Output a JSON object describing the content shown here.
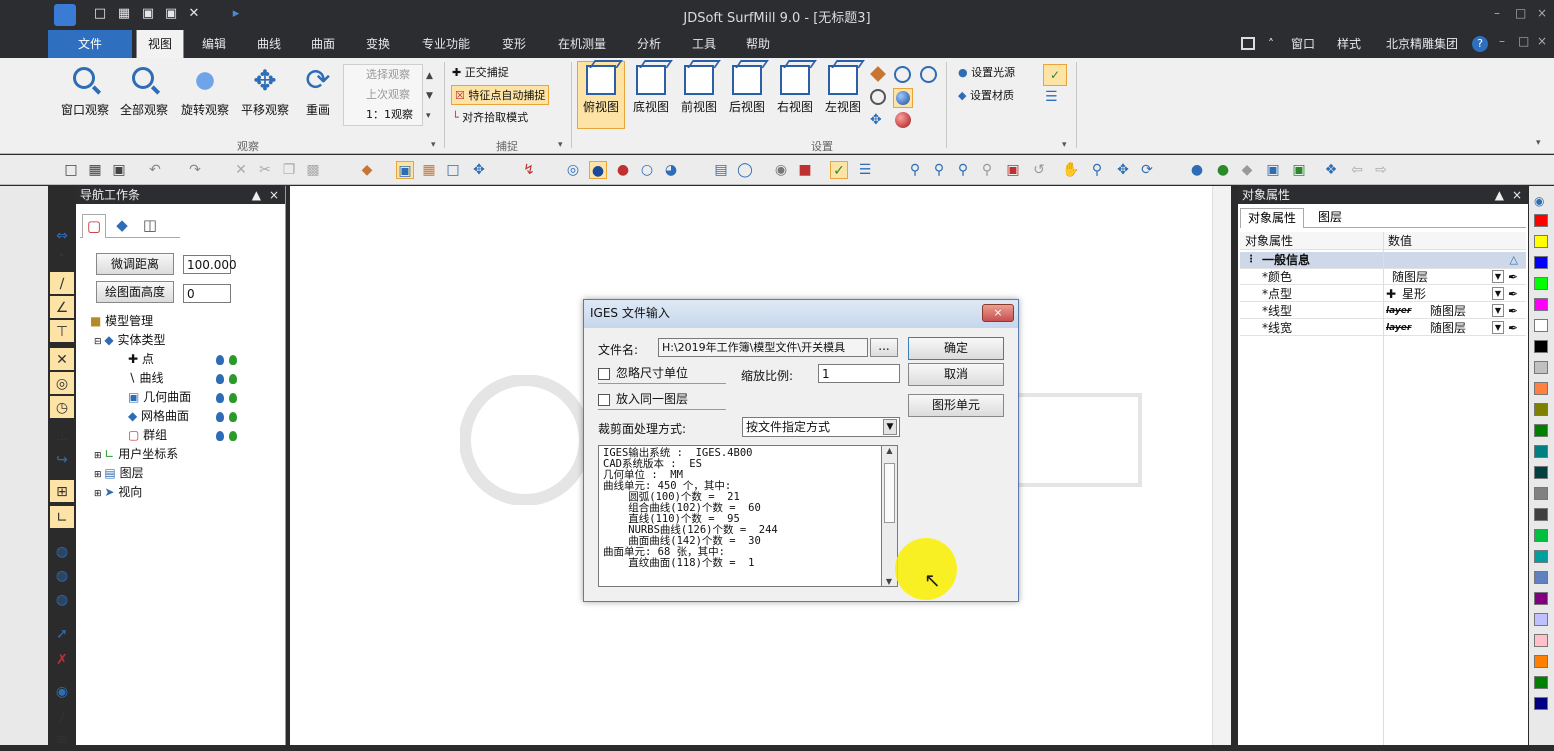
{
  "app": {
    "title": "JDSoft SurfMill 9.0 - [无标题3]",
    "window": {
      "min": "–",
      "max": "□",
      "close": "×"
    }
  },
  "menu": {
    "file": "文件",
    "tabs": [
      "视图",
      "编辑",
      "曲线",
      "曲面",
      "变换",
      "专业功能",
      "变形",
      "在机测量",
      "分析",
      "工具",
      "帮助"
    ],
    "right": {
      "window": "窗口",
      "style": "样式",
      "company": "北京精雕集团",
      "help": "?"
    }
  },
  "ribbon": {
    "observe": {
      "buttons": [
        "窗口观察",
        "全部观察",
        "旋转观察",
        "平移观察",
        "重画"
      ],
      "small": [
        "选择观察",
        "上次观察",
        "1：1观察"
      ],
      "label": "观察"
    },
    "snap": {
      "items": [
        "正交捕捉",
        "特征点自动捕捉",
        "对齐拾取模式"
      ],
      "label": "捕捉"
    },
    "settings": {
      "views": [
        "俯视图",
        "底视图",
        "前视图",
        "后视图",
        "右视图",
        "左视图"
      ],
      "light": "设置光源",
      "material": "设置材质",
      "label": "设置"
    }
  },
  "nav": {
    "title": "导航工作条",
    "fine_label": "微调距离",
    "fine_value": "100.000",
    "draw_label": "绘图面高度",
    "draw_value": "0",
    "tree": {
      "root": "模型管理",
      "entity": "实体类型",
      "children": [
        "点",
        "曲线",
        "几何曲面",
        "网格曲面",
        "群组"
      ],
      "ucs": "用户坐标系",
      "layer": "图层",
      "view": "视向"
    }
  },
  "dialog": {
    "title": "IGES 文件输入",
    "file_label": "文件名:",
    "file_value": "H:\\2019年工作簿\\模型文件\\开关模具",
    "browse": "...",
    "ok": "确定",
    "cancel": "取消",
    "unit_btn": "图形单元",
    "ignore_unit": "忽略尺寸单位",
    "same_layer": "放入同一图层",
    "scale_label": "缩放比例:",
    "scale_value": "1",
    "trim_label": "裁剪面处理方式:",
    "trim_value": "按文件指定方式",
    "info": [
      "IGES输出系统 :  IGES.4B00",
      "CAD系统版本 :  ES",
      "几何单位 :  MM",
      "曲线单元: 450 个，其中:",
      "    圆弧(100)个数 =  21",
      "    组合曲线(102)个数 =  60",
      "    直线(110)个数 =  95",
      "    NURBS曲线(126)个数 =  244",
      "    曲面曲线(142)个数 =  30",
      "曲面单元: 68 张，其中:",
      "    直纹曲面(118)个数 =  1"
    ]
  },
  "props": {
    "title": "对象属性",
    "tabs": [
      "对象属性",
      "图层"
    ],
    "col_prop": "对象属性",
    "col_value": "数值",
    "section": "一般信息",
    "rows": [
      {
        "name": "*颜色",
        "value": "随图层"
      },
      {
        "name": "*点型",
        "value": "星形"
      },
      {
        "name": "*线型",
        "value": "随图层",
        "tag": "layer"
      },
      {
        "name": "*线宽",
        "value": "随图层",
        "tag": "layer"
      }
    ]
  },
  "palette": [
    "#ff0000",
    "#ffff00",
    "#0000ff",
    "#00ff00",
    "#ff00ff",
    "#ffffff",
    "#000000",
    "#c0c0c0",
    "#ff8040",
    "#808000",
    "#008000",
    "#008080",
    "#004040",
    "#808080",
    "#404040",
    "#00c040",
    "#00a0a0",
    "#6080c0",
    "#800080",
    "#c0c0ff",
    "#ffc0cb",
    "#ff8000",
    "#008000",
    "#000080"
  ],
  "colors": {
    "accent": "#2f6fc0",
    "dark": "#2b2d30",
    "highlight": "#fde3a5"
  }
}
